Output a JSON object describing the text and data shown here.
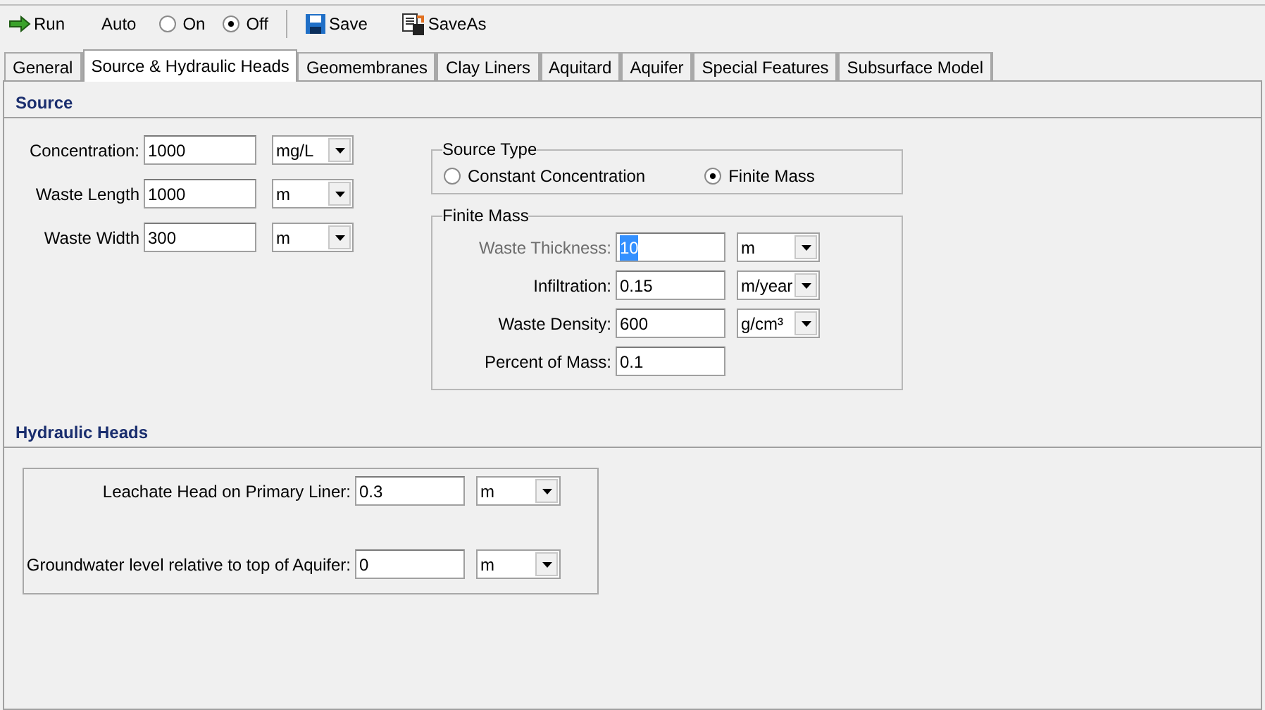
{
  "toolbar": {
    "run": "Run",
    "auto_label": "Auto",
    "auto_options": [
      {
        "label": "On",
        "selected": false
      },
      {
        "label": "Off",
        "selected": true
      }
    ],
    "save": "Save",
    "save_as": "SaveAs"
  },
  "tabs": [
    {
      "label": "General",
      "selected": false
    },
    {
      "label": "Source & Hydraulic Heads",
      "selected": true
    },
    {
      "label": "Geomembranes",
      "selected": false
    },
    {
      "label": "Clay Liners",
      "selected": false
    },
    {
      "label": "Aquitard",
      "selected": false
    },
    {
      "label": "Aquifer",
      "selected": false
    },
    {
      "label": "Special Features",
      "selected": false
    },
    {
      "label": "Subsurface Model",
      "selected": false
    }
  ],
  "source": {
    "title": "Source",
    "fields": [
      {
        "label": "Concentration:",
        "value": "1000",
        "unit": "mg/L"
      },
      {
        "label": "Waste Length",
        "value": "1000",
        "unit": "m"
      },
      {
        "label": "Waste Width",
        "value": "300",
        "unit": "m"
      }
    ],
    "source_type": {
      "title": "Source Type",
      "options": [
        {
          "label": "Constant Concentration",
          "selected": false
        },
        {
          "label": "Finite Mass",
          "selected": true
        }
      ]
    },
    "finite_mass": {
      "title": "Finite Mass",
      "fields": [
        {
          "label": "Waste Thickness:",
          "value": "10",
          "unit": "m",
          "dimmed": true,
          "text_selected": true
        },
        {
          "label": "Infiltration:",
          "value": "0.15",
          "unit": "m/year",
          "dimmed": false,
          "text_selected": false
        },
        {
          "label": "Waste Density:",
          "value": "600",
          "unit": "g/cm³",
          "dimmed": false,
          "text_selected": false
        },
        {
          "label": "Percent of Mass:",
          "value": "0.1",
          "dimmed": false,
          "text_selected": false
        }
      ]
    }
  },
  "hydraulic_heads": {
    "title": "Hydraulic Heads",
    "fields": [
      {
        "label": "Leachate Head on Primary Liner:",
        "value": "0.3",
        "unit": "m"
      },
      {
        "label": "Groundwater level relative to top of Aquifer:",
        "value": "0",
        "unit": "m"
      }
    ]
  }
}
